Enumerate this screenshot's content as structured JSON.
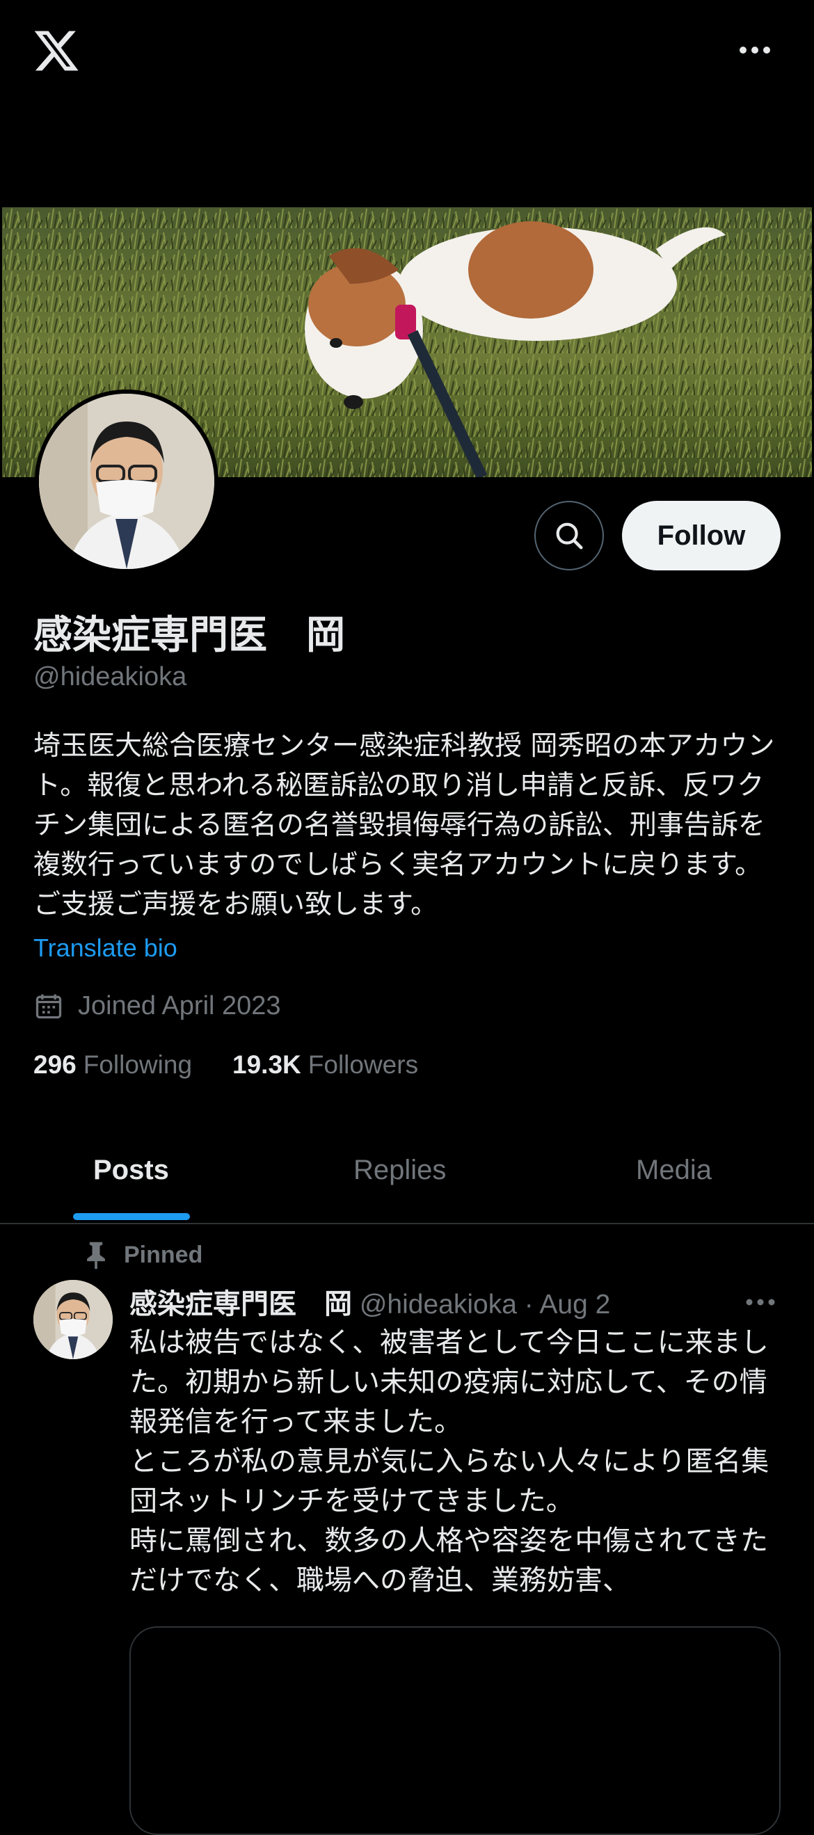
{
  "top_bar": {
    "logo_icon": "x-logo-icon",
    "more_icon": "more-horizontal-icon"
  },
  "profile": {
    "display_name": "感染症専門医　岡",
    "handle": "@hideakioka",
    "bio": "埼玉医大総合医療センター感染症科教授 岡秀昭の本アカウント。報復と思われる秘匿訴訟の取り消し申請と反訴、反ワクチン集団による匿名の名誉毀損侮辱行為の訴訟、刑事告訴を複数行っていますのでしばらく実名アカウントに戻ります。ご支援ご声援をお願い致します。",
    "translate_label": "Translate bio",
    "joined": "Joined April 2023",
    "following_count": "296",
    "following_label": "Following",
    "followers_count": "19.3K",
    "followers_label": "Followers"
  },
  "actions": {
    "search_icon": "search-icon",
    "follow_label": "Follow"
  },
  "tabs": [
    {
      "label": "Posts",
      "active": true
    },
    {
      "label": "Replies",
      "active": false
    },
    {
      "label": "Media",
      "active": false
    }
  ],
  "pinned_post": {
    "pinned_label": "Pinned",
    "author_name": "感染症専門医　岡",
    "meta": " @hideakioka · Aug 2",
    "text": "私は被告ではなく、被害者として今日ここに来ました。初期から新しい未知の疫病に対応して、その情報発信を行って来ました。\nところが私の意見が気に入らない人々により匿名集団ネットリンチを受けてきました。\n時に罵倒され、数多の人格や容姿を中傷されてきただけでなく、職場への脅迫、業務妨害、"
  },
  "colors": {
    "background": "#000000",
    "primary_text": "#e7e9ea",
    "secondary_text": "#71767b",
    "accent": "#1d9bf0",
    "follow_button_bg": "#eff3f4"
  }
}
